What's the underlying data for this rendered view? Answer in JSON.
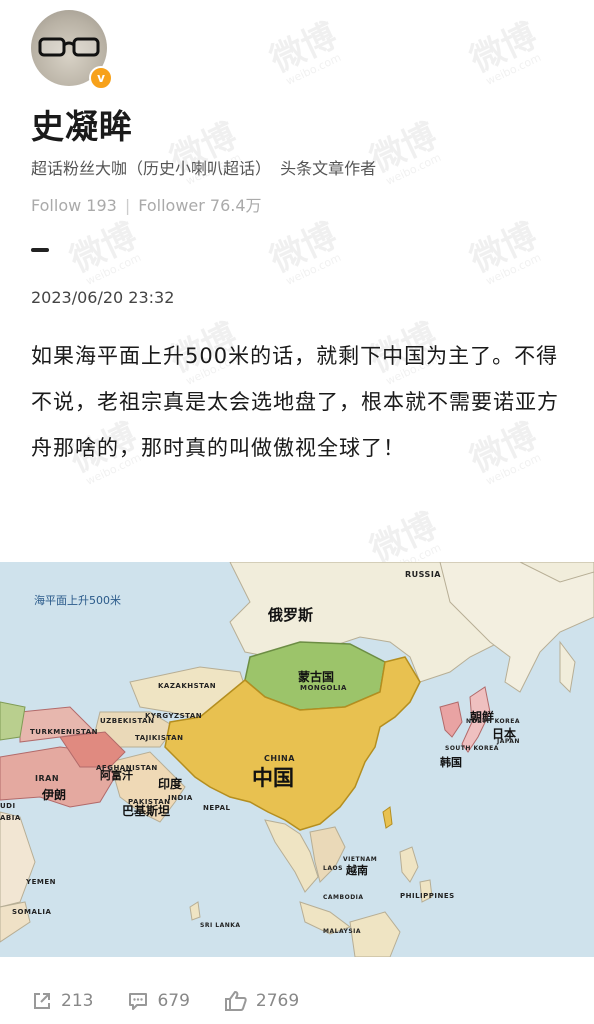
{
  "user": {
    "name": "史凝眸",
    "verified_mark": "v",
    "badges": [
      "超话粉丝大咖（历史小喇叭超话）",
      "头条文章作者"
    ],
    "follow_label": "Follow",
    "follow_count": "193",
    "follower_label": "Follower",
    "follower_count": "76.4万"
  },
  "post": {
    "date": "2023/06/20 23:32",
    "text": "如果海平面上升500米的话，就剩下中国为主了。不得不说，老祖宗真是太会选地盘了，根本就不需要诺亚方舟那啥的，那时真的叫做傲视全球了！"
  },
  "map": {
    "caption": "海平面上升500米",
    "labels": {
      "russia": "RUSSIA",
      "russia_cn": "俄罗斯",
      "mongolia_cn": "蒙古国",
      "mongolia": "MONGOLIA",
      "kazakhstan": "KAZAKHSTAN",
      "uzbekistan": "UZBEKISTAN",
      "kyrgyzstan": "KYRGYZSTAN",
      "turkmenistan": "TURKMENISTAN",
      "tajikistan": "TAJIKISTAN",
      "afghanistan": "AFGHANISTAN",
      "afghanistan_cn": "阿富汗",
      "iran": "IRAN",
      "iran_cn": "伊朗",
      "pakistan": "PAKISTAN",
      "pakistan_cn": "巴基斯坦",
      "india": "INDIA",
      "india_cn": "印度",
      "nepal": "NEPAL",
      "china": "CHINA",
      "china_cn": "中国",
      "north_korea_cn": "朝鲜",
      "north_korea": "NORTH KOREA",
      "south_korea": "SOUTH KOREA",
      "south_korea_cn": "韩国",
      "japan_cn": "日本",
      "japan": "JAPAN",
      "vietnam": "VIETNAM",
      "vietnam_cn": "越南",
      "laos": "LAOS",
      "cambodia": "CAMBODIA",
      "philippines": "PHILIPPINES",
      "malaysia": "MALAYSIA",
      "sri_lanka": "SRI LANKA",
      "yemen": "YEMEN",
      "somalia": "SOMALIA",
      "saudi_partial": "UDI",
      "arabia_partial": "ABIA"
    }
  },
  "actions": {
    "share_count": "213",
    "comment_count": "679",
    "like_count": "2769"
  },
  "watermark": {
    "text": "微博",
    "sub": "weibo.com"
  },
  "colors": {
    "china": "#e8c150",
    "mongolia": "#9cc46a",
    "russia": "#f1eddb",
    "sea": "#cfe2ec",
    "verify": "#f7a11a"
  }
}
